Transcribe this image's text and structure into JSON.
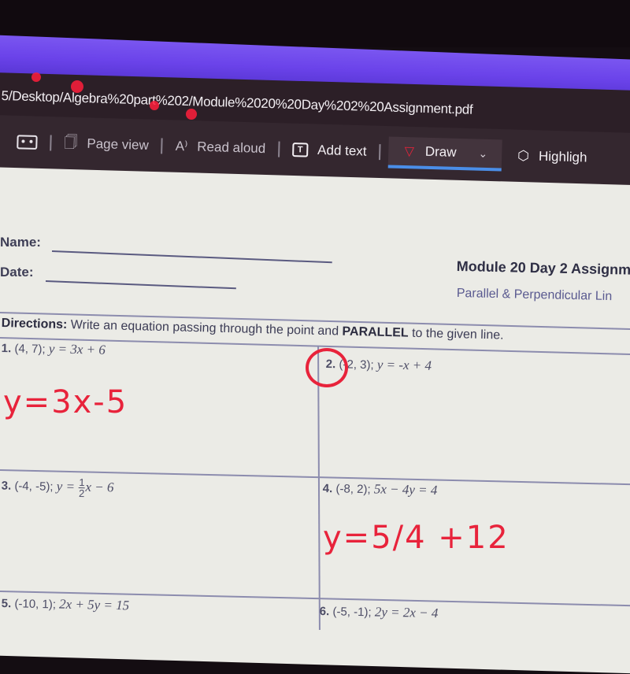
{
  "browser": {
    "url_path": "5/Desktop/Algebra%20part%202/Module%2020%20Day%202%20Assignment.pdf",
    "accent_color": "#6b43ea"
  },
  "toolbar": {
    "items": [
      {
        "icon": "fit-icon",
        "label": ""
      },
      {
        "icon": "page-view-icon",
        "label": "Page view"
      },
      {
        "icon": "read-aloud-icon",
        "label": "Read aloud"
      },
      {
        "icon": "add-text-icon",
        "label": "Add text"
      },
      {
        "icon": "draw-icon",
        "label": "Draw",
        "active": true
      },
      {
        "icon": "highlight-icon",
        "label": "Highligh"
      }
    ],
    "active_underline_color": "#4a8ee8"
  },
  "document": {
    "name_label": "Name:",
    "date_label": "Date:",
    "title": "Module 20 Day 2 Assignm",
    "subtitle": "Parallel & Perpendicular Lin",
    "directions_label": "Directions:",
    "directions_text": " Write an equation passing through the point and ",
    "directions_bold": "PARALLEL",
    "directions_end": " to the given line.",
    "problems": [
      {
        "num": "1.",
        "point": "(4, 7);",
        "equation": "y = 3x + 6",
        "answer": "y=3x-5"
      },
      {
        "num": "2.",
        "point": "(-2, 3);",
        "equation": "y = -x + 4",
        "answer": "",
        "circled": true
      },
      {
        "num": "3.",
        "point": "(-4, -5);",
        "equation_prefix": "y =",
        "fraction_num": "1",
        "fraction_den": "2",
        "equation_suffix": "x − 6",
        "answer": ""
      },
      {
        "num": "4.",
        "point": "(-8, 2);",
        "equation": "5x − 4y = 4",
        "answer": "y=5/4 +12"
      },
      {
        "num": "5.",
        "point": "(-10, 1);",
        "equation": "2x + 5y = 15",
        "answer": ""
      },
      {
        "num": "6.",
        "point": "(-5, -1);",
        "equation": "2y = 2x − 4",
        "answer": ""
      }
    ],
    "ink_color": "#e8233b"
  }
}
